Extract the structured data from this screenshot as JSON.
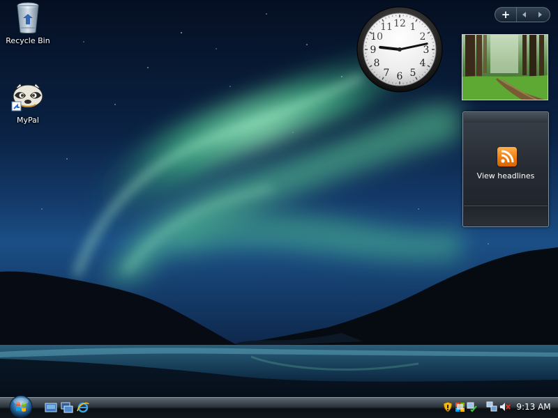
{
  "desktop": {
    "icons": [
      {
        "label": "Recycle Bin",
        "icon": "recycle-bin-icon"
      },
      {
        "label": "MyPal",
        "icon": "raccoon-shortcut-icon"
      }
    ]
  },
  "sidebar": {
    "controls": {
      "add_label": "+",
      "prev_icon": "arrow-left-icon",
      "next_icon": "arrow-right-icon"
    }
  },
  "gadgets": {
    "clock": {
      "time": "9:13",
      "numerals": [
        "12",
        "1",
        "2",
        "3",
        "4",
        "5",
        "6",
        "7",
        "8",
        "9",
        "10",
        "11"
      ]
    },
    "slideshow": {
      "icon": "forest-path-photo"
    },
    "feed": {
      "label": "View headlines",
      "icon": "rss-icon"
    }
  },
  "taskbar": {
    "start_icon": "windows-orb-icon",
    "quick_launch": [
      "show-desktop-icon",
      "switch-windows-icon",
      "internet-explorer-icon"
    ],
    "tray_icons": [
      "security-shield-icon",
      "security-center-icon",
      "network-icon",
      "volume-muted-icon"
    ],
    "clock": "9:13 AM"
  },
  "colors": {
    "aurora": "#6dd6a0",
    "sky": "#0b2446",
    "taskbar": "#1a2128"
  }
}
